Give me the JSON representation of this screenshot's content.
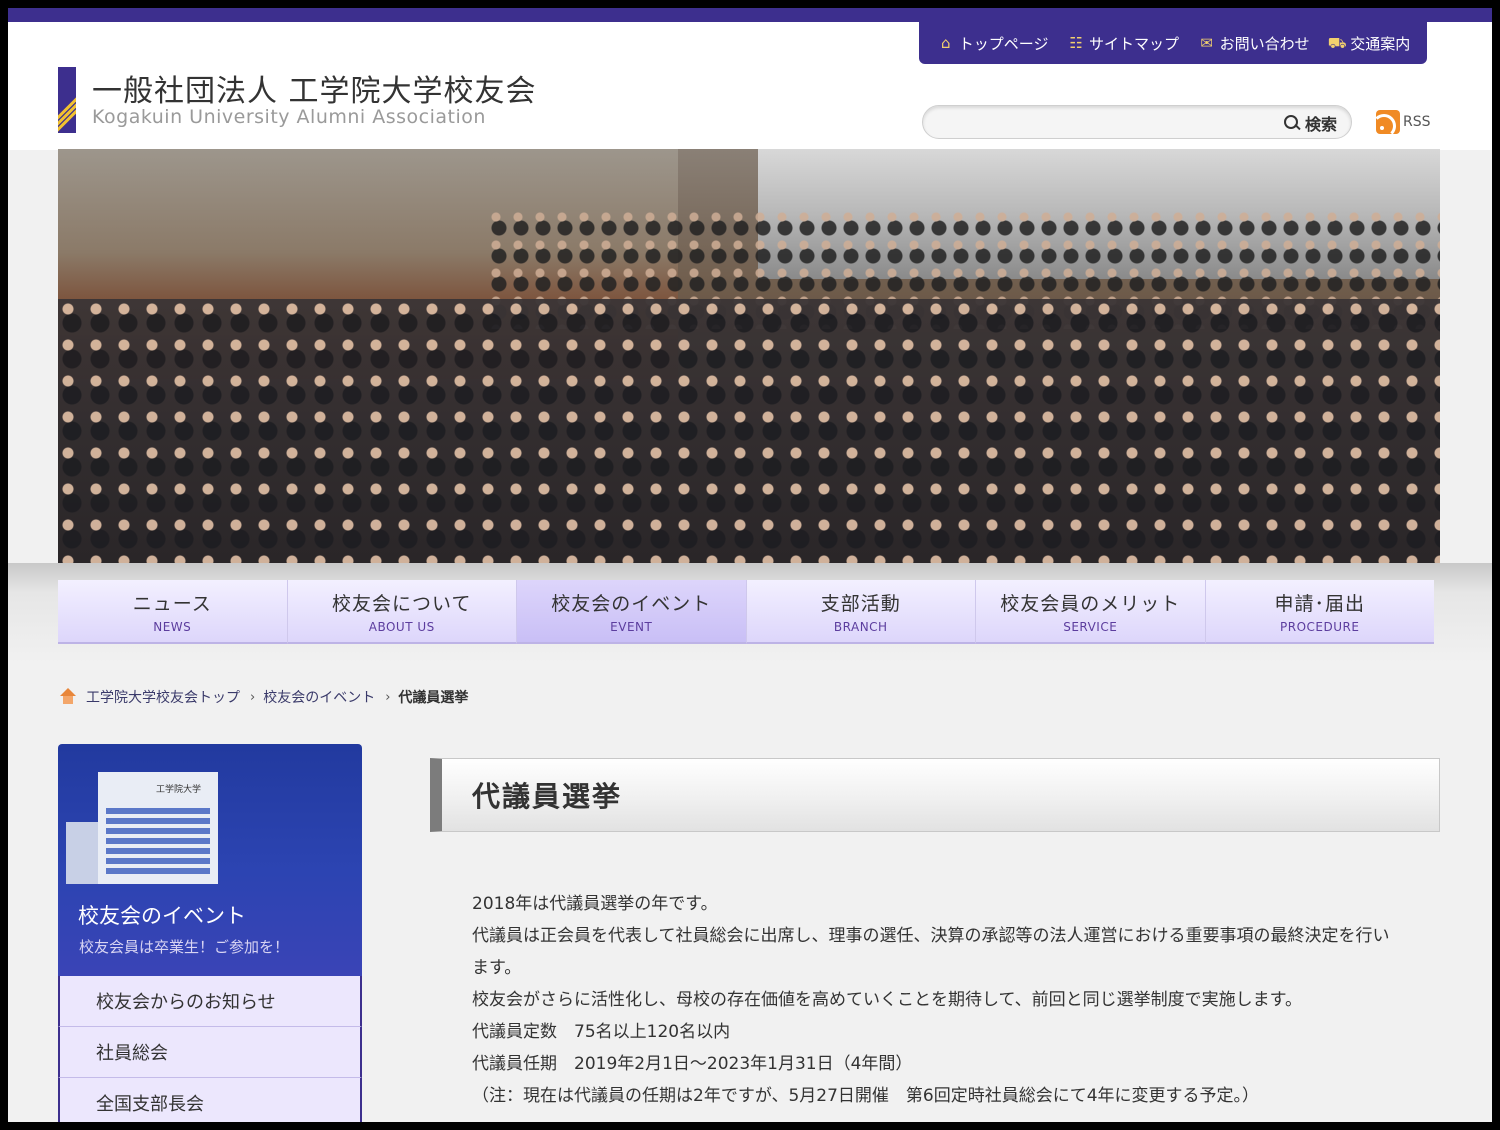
{
  "header": {
    "org_name": "一般社団法人 工学院大学校友会",
    "org_name_en": "Kogakuin University Alumni Association"
  },
  "util_nav": [
    {
      "label": "トップページ",
      "icon": "home-icon"
    },
    {
      "label": "サイトマップ",
      "icon": "sitemap-icon"
    },
    {
      "label": "お問い合わせ",
      "icon": "mail-icon"
    },
    {
      "label": "交通案内",
      "icon": "car-icon"
    }
  ],
  "search": {
    "placeholder": "",
    "button_label": "検索"
  },
  "rss": {
    "label": "RSS"
  },
  "main_nav": [
    {
      "jp": "ニュース",
      "en": "NEWS"
    },
    {
      "jp": "校友会について",
      "en": "ABOUT US"
    },
    {
      "jp": "校友会のイベント",
      "en": "EVENT"
    },
    {
      "jp": "支部活動",
      "en": "BRANCH"
    },
    {
      "jp": "校友会員のメリット",
      "en": "SERVICE"
    },
    {
      "jp": "申請･届出",
      "en": "PROCEDURE"
    }
  ],
  "breadcrumb": {
    "home": "工学院大学校友会トップ",
    "section": "校友会のイベント",
    "current": "代議員選挙",
    "separator": "›"
  },
  "sidebar": {
    "building_sign": "工学院大学",
    "title": "校友会のイベント",
    "subtitle": "校友会員は卒業生！ご参加を！",
    "items": [
      {
        "label": "校友会からのお知らせ"
      },
      {
        "label": "社員総会"
      },
      {
        "label": "全国支部長会"
      }
    ]
  },
  "content": {
    "title": "代議員選挙",
    "paragraphs": [
      "2018年は代議員選挙の年です。",
      "代議員は正会員を代表して社員総会に出席し、理事の選任、決算の承認等の法人運営における重要事項の最終決定を行います。",
      "校友会がさらに活性化し、母校の存在価値を高めていくことを期待して、前回と同じ選挙制度で実施します。",
      "代議員定数　75名以上120名以内",
      "代議員任期　2019年2月1日～2023年1月31日（4年間）",
      "（注：現在は代議員の任期は2年ですが、5月27日開催　第6回定時社員総会にて4年に変更する予定。）"
    ]
  },
  "colors": {
    "brand": "#3d2f8e",
    "accent_gold": "#f2c230",
    "nav_bg": "#ddd6fb"
  }
}
